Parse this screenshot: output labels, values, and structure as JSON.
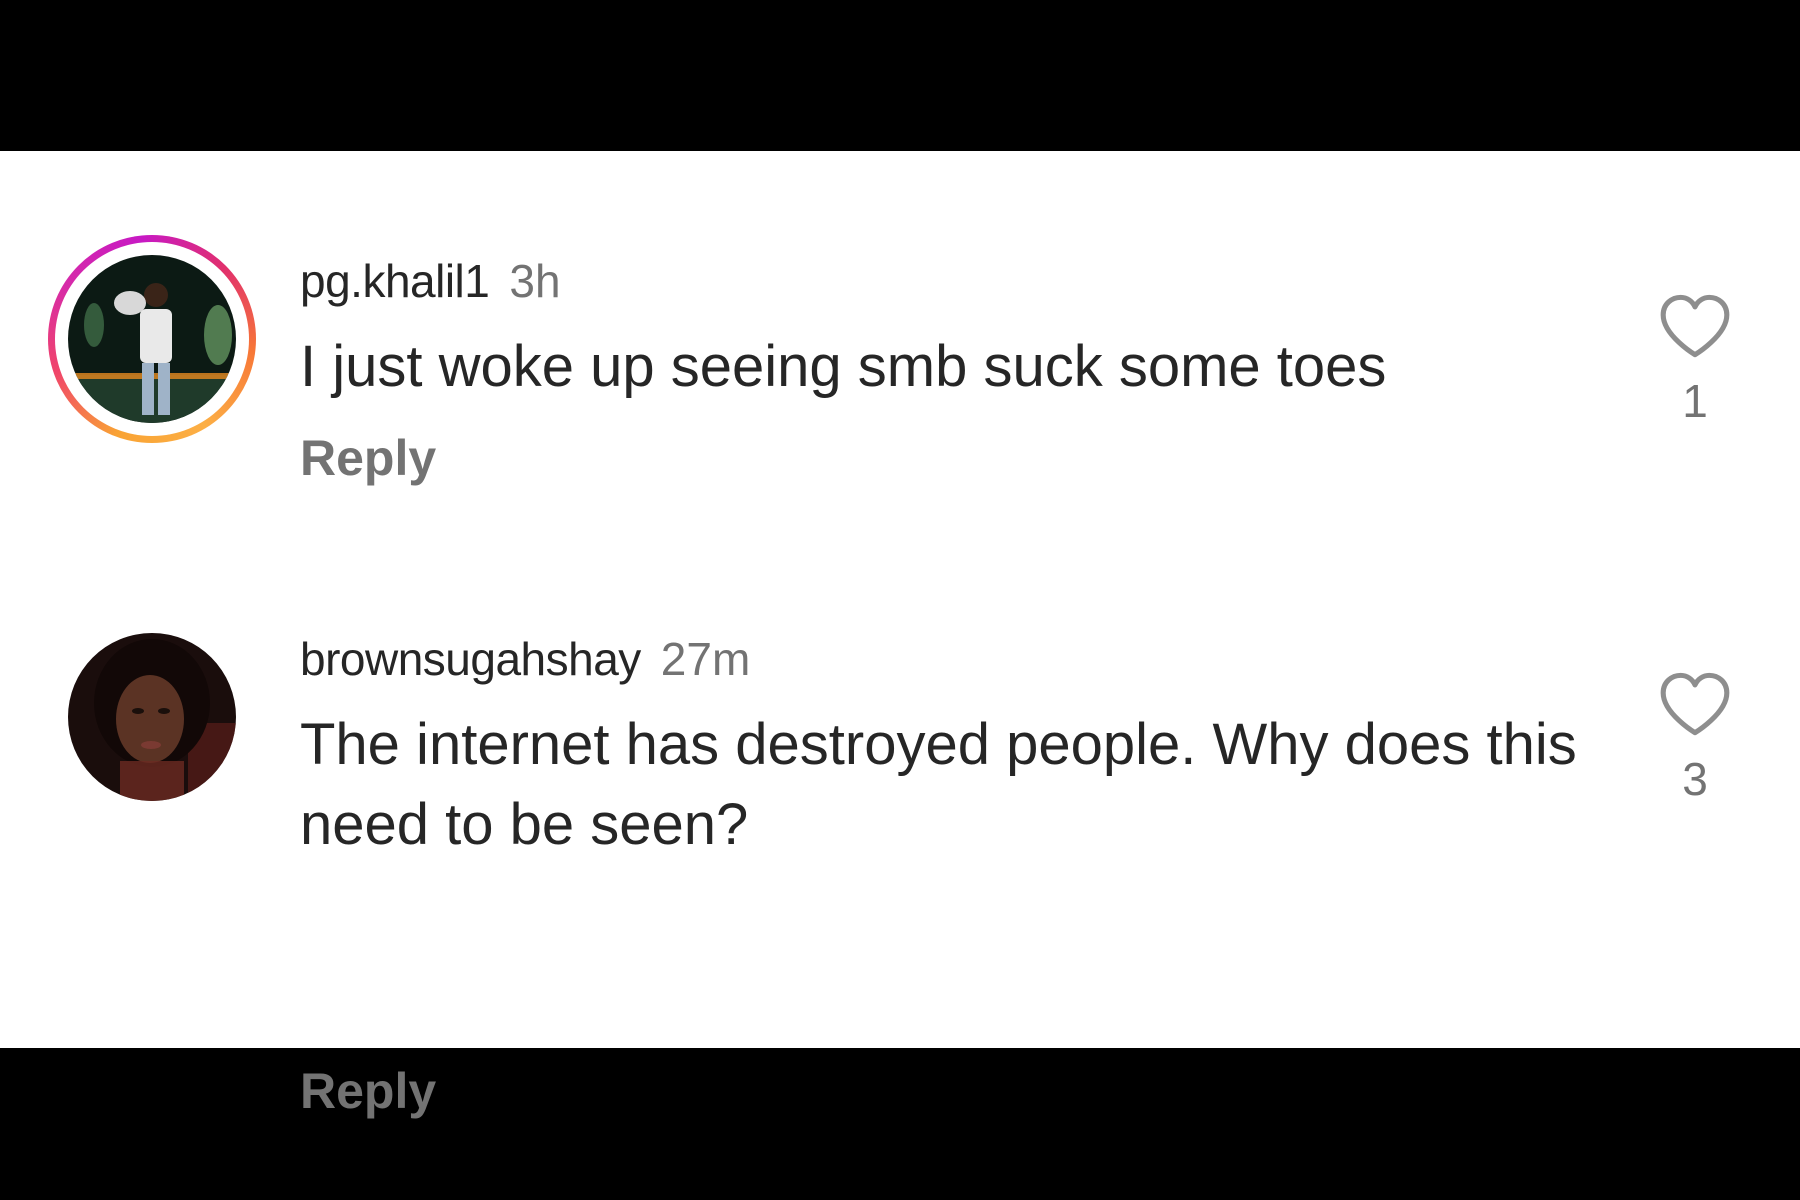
{
  "comments": [
    {
      "username": "pg.khalil1",
      "time": "3h",
      "text": "I just woke up seeing smb suck some toes",
      "reply_label": "Reply",
      "like_count": "1",
      "has_story_ring": true
    },
    {
      "username": "brownsugahshay",
      "time": "27m",
      "text": "The internet has destroyed people. Why does this need to be seen?",
      "reply_label": "Reply",
      "like_count": "3",
      "has_story_ring": false
    }
  ],
  "icons": {
    "like": "heart-outline-icon"
  },
  "colors": {
    "text_primary": "#262626",
    "text_secondary": "#737373",
    "background": "#ffffff",
    "letterbox": "#000000"
  }
}
